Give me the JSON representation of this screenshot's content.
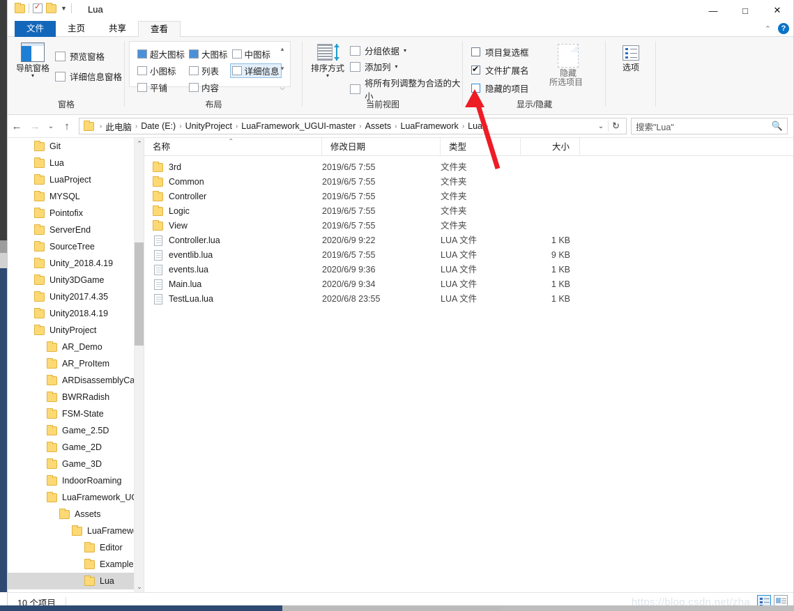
{
  "window": {
    "title": "Lua",
    "quick_access": [
      "folder-icon",
      "properties-icon",
      "new-folder-icon",
      "customize-caret"
    ],
    "controls": {
      "minimize": "—",
      "maximize": "□",
      "close": "✕"
    }
  },
  "tabs": [
    {
      "label": "文件",
      "state": "file"
    },
    {
      "label": "主页",
      "state": "normal"
    },
    {
      "label": "共享",
      "state": "normal"
    },
    {
      "label": "查看",
      "state": "active"
    }
  ],
  "tab_right": {
    "collapse": "⌃",
    "help": "?"
  },
  "ribbon": {
    "groups": [
      {
        "name": "panes",
        "label": "窗格",
        "big_button": {
          "label1": "导航窗格",
          "dropdown": "▾",
          "icon": "nav-pane-icon"
        },
        "items": [
          {
            "label": "预览窗格",
            "icon": "preview-pane-icon"
          },
          {
            "label": "详细信息窗格",
            "icon": "details-pane-icon"
          }
        ]
      },
      {
        "name": "layout",
        "label": "布局",
        "items": [
          {
            "label": "超大图标",
            "icon": "extra-large-icons-icon",
            "selected": false
          },
          {
            "label": "大图标",
            "icon": "large-icons-icon",
            "selected": false
          },
          {
            "label": "中图标",
            "icon": "medium-icons-icon",
            "selected": false
          },
          {
            "label": "小图标",
            "icon": "small-icons-icon",
            "selected": false
          },
          {
            "label": "列表",
            "icon": "list-view-icon",
            "selected": false
          },
          {
            "label": "详细信息",
            "icon": "details-view-icon",
            "selected": true
          },
          {
            "label": "平铺",
            "icon": "tiles-view-icon",
            "selected": false
          },
          {
            "label": "内容",
            "icon": "content-view-icon",
            "selected": false
          }
        ],
        "scroll": {
          "up": "▴",
          "more": "▾",
          "down": "⌵"
        }
      },
      {
        "name": "current-view",
        "label": "当前视图",
        "big_button": {
          "label1": "排序方式",
          "dropdown": "▾",
          "icon": "sort-by-icon"
        },
        "items": [
          {
            "label": "分组依据",
            "icon": "group-by-icon",
            "dropdown": "▾"
          },
          {
            "label": "添加列",
            "icon": "add-column-icon",
            "dropdown": "▾"
          },
          {
            "label": "将所有列调整为合适的大小",
            "icon": "size-columns-icon",
            "dropdown": ""
          }
        ]
      },
      {
        "name": "show-hide",
        "label": "显示/隐藏",
        "checkboxes": [
          {
            "label": "项目复选框",
            "checked": false,
            "highlight": false
          },
          {
            "label": "文件扩展名",
            "checked": true,
            "highlight": false
          },
          {
            "label": "隐藏的项目",
            "checked": false,
            "highlight": true
          }
        ],
        "hide_button": {
          "label1": "隐藏",
          "label2": "所选项目",
          "icon": "hide-selected-icon"
        }
      },
      {
        "name": "options",
        "label": "",
        "big_button": {
          "label1": "选项",
          "icon": "options-icon"
        }
      }
    ]
  },
  "address": {
    "back": "←",
    "forward": "→",
    "recent": "⌄",
    "up": "↑",
    "folder_icon": "folder-icon",
    "crumbs": [
      "此电脑",
      "Date (E:)",
      "UnityProject",
      "LuaFramework_UGUI-master",
      "Assets",
      "LuaFramework",
      "Lua"
    ],
    "separator": "›",
    "dropdown": "⌄",
    "refresh": "↻"
  },
  "search": {
    "placeholder": "搜索\"Lua\"",
    "icon": "search-icon"
  },
  "nav_tree": {
    "items": [
      {
        "label": "Git",
        "indent": 0,
        "selected": false
      },
      {
        "label": "Lua",
        "indent": 0,
        "selected": false
      },
      {
        "label": "LuaProject",
        "indent": 0,
        "selected": false
      },
      {
        "label": "MYSQL",
        "indent": 0,
        "selected": false
      },
      {
        "label": "Pointofix",
        "indent": 0,
        "selected": false
      },
      {
        "label": "ServerEnd",
        "indent": 0,
        "selected": false
      },
      {
        "label": "SourceTree",
        "indent": 0,
        "selected": false
      },
      {
        "label": "Unity_2018.4.19",
        "indent": 0,
        "selected": false
      },
      {
        "label": "Unity3DGame",
        "indent": 0,
        "selected": false
      },
      {
        "label": "Unity2017.4.35",
        "indent": 0,
        "selected": false
      },
      {
        "label": "Unity2018.4.19",
        "indent": 0,
        "selected": false
      },
      {
        "label": "UnityProject",
        "indent": 0,
        "selected": false
      },
      {
        "label": "AR_Demo",
        "indent": 1,
        "selected": false
      },
      {
        "label": "AR_ProItem",
        "indent": 1,
        "selected": false
      },
      {
        "label": "ARDisassemblyCar",
        "indent": 1,
        "selected": false
      },
      {
        "label": "BWRRadish",
        "indent": 1,
        "selected": false
      },
      {
        "label": "FSM-State",
        "indent": 1,
        "selected": false
      },
      {
        "label": "Game_2.5D",
        "indent": 1,
        "selected": false
      },
      {
        "label": "Game_2D",
        "indent": 1,
        "selected": false
      },
      {
        "label": "Game_3D",
        "indent": 1,
        "selected": false
      },
      {
        "label": "IndoorRoaming",
        "indent": 1,
        "selected": false
      },
      {
        "label": "LuaFramework_UGUI-master",
        "indent": 1,
        "selected": false
      },
      {
        "label": "Assets",
        "indent": 2,
        "selected": false
      },
      {
        "label": "LuaFramework",
        "indent": 3,
        "selected": false
      },
      {
        "label": "Editor",
        "indent": 4,
        "selected": false
      },
      {
        "label": "Examples",
        "indent": 4,
        "selected": false
      },
      {
        "label": "Lua",
        "indent": 4,
        "selected": true
      }
    ],
    "scroll_up": "⌃",
    "scroll_down": "⌄"
  },
  "file_list": {
    "columns": [
      {
        "key": "name",
        "label": "名称",
        "sorted": true,
        "sort_arrow": "⌃"
      },
      {
        "key": "date",
        "label": "修改日期"
      },
      {
        "key": "type",
        "label": "类型"
      },
      {
        "key": "size",
        "label": "大小"
      }
    ],
    "rows": [
      {
        "name": "3rd",
        "date": "2019/6/5 7:55",
        "type": "文件夹",
        "size": "",
        "kind": "folder"
      },
      {
        "name": "Common",
        "date": "2019/6/5 7:55",
        "type": "文件夹",
        "size": "",
        "kind": "folder"
      },
      {
        "name": "Controller",
        "date": "2019/6/5 7:55",
        "type": "文件夹",
        "size": "",
        "kind": "folder"
      },
      {
        "name": "Logic",
        "date": "2019/6/5 7:55",
        "type": "文件夹",
        "size": "",
        "kind": "folder"
      },
      {
        "name": "View",
        "date": "2019/6/5 7:55",
        "type": "文件夹",
        "size": "",
        "kind": "folder"
      },
      {
        "name": "Controller.lua",
        "date": "2020/6/9 9:22",
        "type": "LUA 文件",
        "size": "1 KB",
        "kind": "file"
      },
      {
        "name": "eventlib.lua",
        "date": "2019/6/5 7:55",
        "type": "LUA 文件",
        "size": "9 KB",
        "kind": "file"
      },
      {
        "name": "events.lua",
        "date": "2020/6/9 9:36",
        "type": "LUA 文件",
        "size": "1 KB",
        "kind": "file"
      },
      {
        "name": "Main.lua",
        "date": "2020/6/9 9:34",
        "type": "LUA 文件",
        "size": "1 KB",
        "kind": "file"
      },
      {
        "name": "TestLua.lua",
        "date": "2020/6/8 23:55",
        "type": "LUA 文件",
        "size": "1 KB",
        "kind": "file"
      }
    ]
  },
  "status": {
    "count": "10 个项目",
    "watermark": "https://blog.csdn.net/zha",
    "view_details": "details-view-toggle",
    "view_large": "large-icons-view-toggle"
  },
  "annotation": {
    "arrow_color": "#ee1c25",
    "points_to": "隐藏的项目"
  }
}
